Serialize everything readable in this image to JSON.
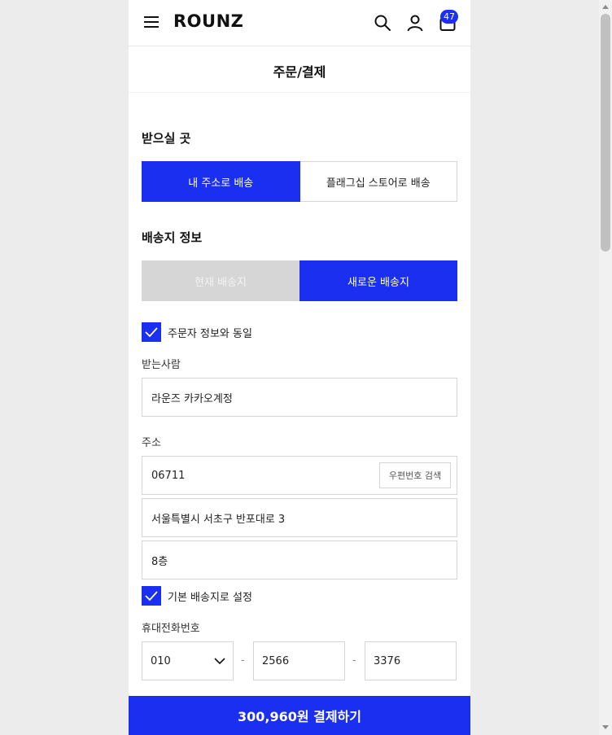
{
  "header": {
    "logo": "ROUNZ",
    "cart_count": "47"
  },
  "page": {
    "title": "주문/결제"
  },
  "delivery_location": {
    "heading": "받으실 곳",
    "options": [
      "내 주소로 배송",
      "플래그십 스토어로 배송"
    ],
    "selected": "내 주소로 배송"
  },
  "shipping_info": {
    "heading": "배송지 정보",
    "options": [
      "현재 배송지",
      "새로운 배송지"
    ],
    "selected": "새로운 배송지",
    "same_as_orderer_label": "주문자 정보와 동일",
    "same_as_orderer_checked": true,
    "recipient_label": "받는사람",
    "recipient_value": "라운즈 카카오계정",
    "address_label": "주소",
    "zip_value": "06711",
    "zip_button": "우편번호 검색",
    "address_line1": "서울특별시 서초구 반포대로 3",
    "address_line2": "8층",
    "default_address_label": "기본 배송지로 설정",
    "default_address_checked": true,
    "phone_label": "휴대전화번호",
    "phone_prefix": "010",
    "phone_dash": "-",
    "phone_middle": "2566",
    "phone_last": "3376"
  },
  "pay_button": "300,960원 결제하기",
  "colors": {
    "accent": "#1a2ff0",
    "disabled": "#d6d6d6"
  }
}
